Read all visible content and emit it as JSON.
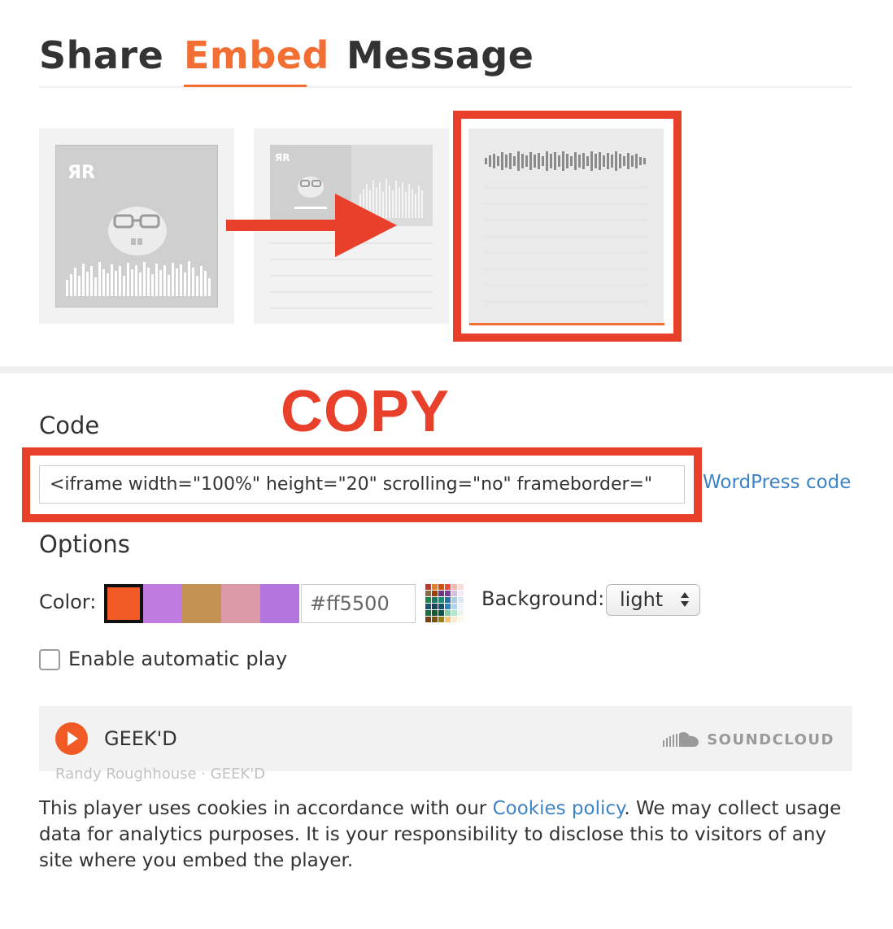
{
  "tabs": [
    {
      "label": "Share"
    },
    {
      "label": "Embed",
      "active": true
    },
    {
      "label": "Message"
    }
  ],
  "annotation": {
    "copy_label": "COPY",
    "highlight_color": "#e8402a"
  },
  "variants": {
    "selected_index": 2,
    "visual_art_label": "GEEK'D"
  },
  "code": {
    "label": "Code",
    "value": "<iframe width=\"100%\" height=\"20\" scrolling=\"no\" frameborder=\"",
    "wordpress_link": "WordPress code"
  },
  "options": {
    "label": "Options",
    "color_label": "Color:",
    "swatches": [
      "#f15a24",
      "#c07be0",
      "#c49352",
      "#dc9aa6",
      "#b276de"
    ],
    "selected_swatch": 0,
    "hex_value": "#ff5500",
    "background_label": "Background:",
    "background_value": "light",
    "autoplay_label": "Enable automatic play",
    "autoplay_checked": false
  },
  "player": {
    "track_title": "GEEK'D",
    "brand": "SOUNDCLOUD",
    "subtitle": "Randy Roughhouse · GEEK'D"
  },
  "footer": {
    "text_before": "This player uses cookies in accordance with our ",
    "link_text": "Cookies policy",
    "text_after": ". We may collect usage data for analytics purposes. It is your responsibility to disclose this to visitors of any site where you embed the player."
  },
  "colors": {
    "accent": "#f26e33",
    "link": "#3c84c5"
  }
}
